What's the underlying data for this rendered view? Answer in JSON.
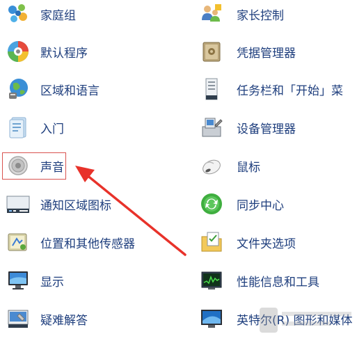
{
  "left_items": [
    {
      "label": "家庭组",
      "icon": "homegroup-icon"
    },
    {
      "label": "默认程序",
      "icon": "default-programs-icon"
    },
    {
      "label": "区域和语言",
      "icon": "region-language-icon"
    },
    {
      "label": "入门",
      "icon": "getting-started-icon"
    },
    {
      "label": "声音",
      "icon": "sound-icon"
    },
    {
      "label": "通知区域图标",
      "icon": "notification-area-icon"
    },
    {
      "label": "位置和其他传感器",
      "icon": "location-sensors-icon"
    },
    {
      "label": "显示",
      "icon": "display-icon"
    },
    {
      "label": "疑难解答",
      "icon": "troubleshooting-icon"
    }
  ],
  "right_items": [
    {
      "label": "家长控制",
      "icon": "parental-controls-icon"
    },
    {
      "label": "凭据管理器",
      "icon": "credential-manager-icon"
    },
    {
      "label": "任务栏和「开始」菜",
      "icon": "taskbar-start-icon"
    },
    {
      "label": "设备管理器",
      "icon": "device-manager-icon"
    },
    {
      "label": "鼠标",
      "icon": "mouse-icon"
    },
    {
      "label": "同步中心",
      "icon": "sync-center-icon"
    },
    {
      "label": "文件夹选项",
      "icon": "folder-options-icon"
    },
    {
      "label": "性能信息和工具",
      "icon": "performance-icon"
    },
    {
      "label": "英特尔(R) 图形和媒体",
      "icon": "intel-graphics-icon"
    }
  ],
  "colors": {
    "label": "#1e3e7d",
    "highlight": "#d9534f",
    "arrow": "#e8322a"
  }
}
